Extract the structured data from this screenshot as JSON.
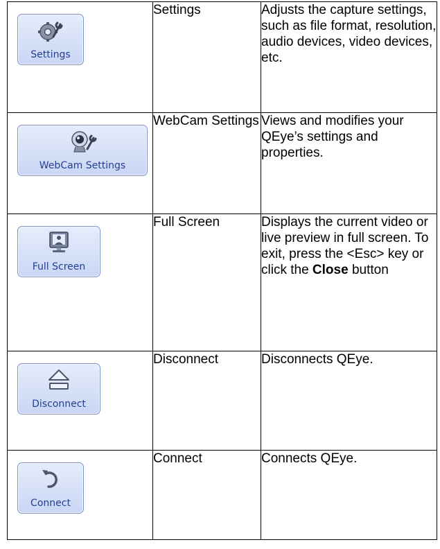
{
  "rows": [
    {
      "button_label": "Settings",
      "icon": "gear-wrench-icon",
      "name": "Settings",
      "description": "Adjusts the capture settings, such as file format, resolution, audio devices, video devices, etc."
    },
    {
      "button_label": "WebCam Settings",
      "icon": "webcam-wrench-icon",
      "name": "WebCam Settings",
      "description": "Views and modifies your QEye’s settings and properties."
    },
    {
      "button_label": "Full Screen",
      "icon": "monitor-icon",
      "name": "Full Screen",
      "description_before": "Displays the current video or live preview in full screen. To exit, press the <Esc> key or click the ",
      "description_bold": "Close",
      "description_after": " button"
    },
    {
      "button_label": "Disconnect",
      "icon": "eject-icon",
      "name": "Disconnect",
      "description": "Disconnects QEye."
    },
    {
      "button_label": "Connect",
      "icon": "reconnect-arrow-icon",
      "name": "Connect",
      "description": "Connects QEye."
    }
  ],
  "colors": {
    "button_fill": "#c9d6f5",
    "button_border": "#7e92c8",
    "button_text": "#23408f"
  }
}
